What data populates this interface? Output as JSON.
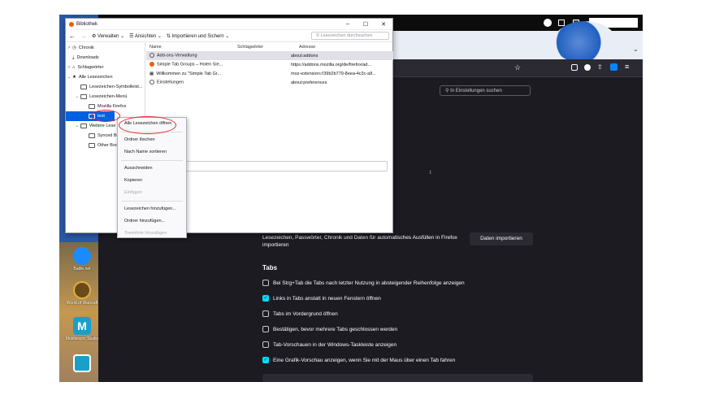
{
  "library": {
    "title": "Bibliothek",
    "window_controls": [
      "–",
      "☐",
      "✕"
    ],
    "toolbar": {
      "back": "←",
      "forward": "→",
      "manage": "Verwalten",
      "views": "Ansichten",
      "import": "Importieren und Sichern",
      "search_placeholder": "Lesezeichen durchsuchen"
    },
    "tree": [
      {
        "label": "Chronik",
        "twisty": ">"
      },
      {
        "label": "Downloads",
        "twisty": ""
      },
      {
        "label": "Schlagwörter",
        "twisty": ">"
      },
      {
        "label": "Alle Lesezeichen",
        "twisty": "⌄"
      },
      {
        "label": "Lesezeichen-Symbolleist...",
        "twisty": ""
      },
      {
        "label": "Lesezeichen-Menü",
        "twisty": "⌄"
      },
      {
        "label": "Mozilla Firefox",
        "twisty": ""
      },
      {
        "label": "test",
        "twisty": ""
      },
      {
        "label": "Weitere Lese",
        "twisty": "⌄"
      },
      {
        "label": "Synced Bo",
        "twisty": ""
      },
      {
        "label": "Other Boo",
        "twisty": ""
      }
    ],
    "columns": [
      "Name",
      "Schlagwörter",
      "Adresse"
    ],
    "rows": [
      {
        "name": "Add-ons-Verwaltung",
        "tags": "",
        "url": "about:addons"
      },
      {
        "name": "Simple Tab Groups – Holen Sie...",
        "tags": "",
        "url": "https://addons.mozilla.org/de/firefox/ad..."
      },
      {
        "name": "Willkommen zu \"Simple Tab Gr...",
        "tags": "",
        "url": "moz-extension://39b2b779-8eea-4c3c-a8..."
      },
      {
        "name": "Einstellungen",
        "tags": "",
        "url": "about:preferences"
      }
    ]
  },
  "context_menu": {
    "items": [
      {
        "label": "Alle Lesezeichen öffnen",
        "disabled": false
      },
      {
        "label": "Ordner löschen",
        "disabled": false
      },
      {
        "label": "Nach Name sortieren",
        "disabled": false
      },
      {
        "label": "Ausschneiden",
        "disabled": false
      },
      {
        "label": "Kopieren",
        "disabled": false
      },
      {
        "label": "Einfügen",
        "disabled": true
      },
      {
        "label": "Lesezeichen hinzufügen...",
        "disabled": false
      },
      {
        "label": "Ordner hinzufügen...",
        "disabled": false
      },
      {
        "label": "Trennlinie hinzufügen",
        "disabled": true
      }
    ]
  },
  "settings": {
    "search_placeholder": "In Einstellungen suchen",
    "import_text": "Lesezeichen, Passwörter, Chronik und Daten für automatisches Ausfüllen in Firefox importieren",
    "import_button": "Daten importieren",
    "tabs_heading": "Tabs",
    "options": [
      {
        "label": "Bei Strg+Tab die Tabs nach letzter Nutzung in absteigender Reihenfolge anzeigen",
        "checked": false
      },
      {
        "label": "Links in Tabs anstatt in neuen Fenstern öffnen",
        "checked": true
      },
      {
        "label": "Tabs im Vordergrund öffnen",
        "checked": false
      },
      {
        "label": "Bestätigen, bevor mehrere Tabs geschlossen werden",
        "checked": false
      },
      {
        "label": "Tab-Vorschauen in der Windows-Taskleiste anzeigen",
        "checked": false
      },
      {
        "label": "Eine Grafik-Vorschau anzeigen, wenn Sie mit der Maus über einen Tab fahren",
        "checked": true
      }
    ]
  },
  "desktop": {
    "icons": [
      {
        "label": "Battle.net",
        "color": "#1a8cff"
      },
      {
        "label": "World of Warcraft",
        "color": "#6a4a18"
      },
      {
        "label": "Mobilesync Studio",
        "color": "#1aa0c8"
      },
      {
        "label": "",
        "color": "#1aa0c8"
      }
    ]
  },
  "accent": "#0061e0",
  "annotation_color": "#e8202a"
}
